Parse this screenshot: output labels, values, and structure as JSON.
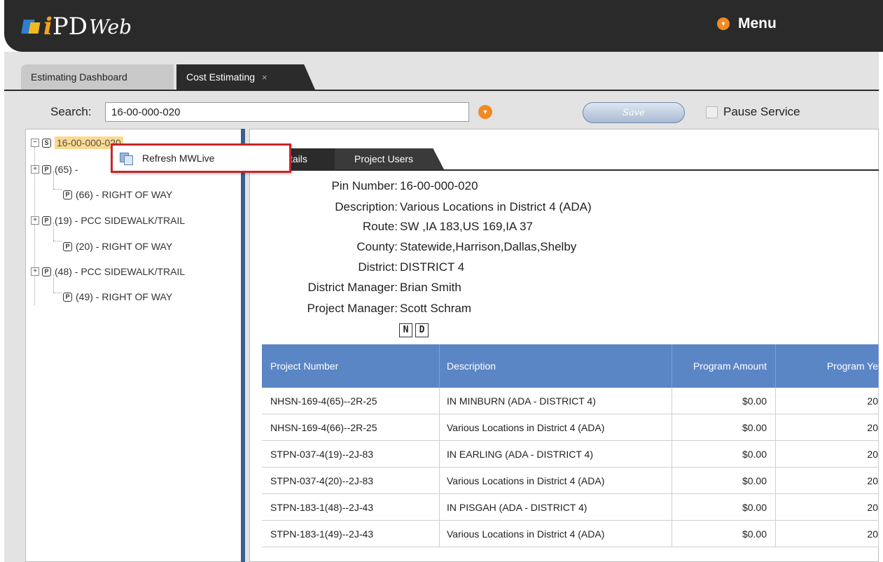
{
  "app": {
    "logo_i": "i",
    "logo_pd": "PD",
    "logo_web": "Web",
    "menu_label": "Menu"
  },
  "tabs": [
    {
      "label": "Estimating Dashboard"
    },
    {
      "label": "Cost Estimating",
      "close": "×"
    }
  ],
  "search": {
    "label": "Search:",
    "value": "16-00-000-020"
  },
  "toolbar": {
    "save_label": "Save",
    "pause_label": "Pause Service"
  },
  "tree": {
    "root": {
      "icon": "S",
      "label": "16-00-000-020",
      "expander": "−"
    },
    "items": [
      {
        "icon": "P",
        "label": "(65) -",
        "expander": "+"
      },
      {
        "icon": "P",
        "label": "(66) - RIGHT OF WAY"
      },
      {
        "icon": "P",
        "label": "(19) - PCC SIDEWALK/TRAIL",
        "expander": "+"
      },
      {
        "icon": "P",
        "label": "(20) - RIGHT OF WAY"
      },
      {
        "icon": "P",
        "label": "(48) - PCC SIDEWALK/TRAIL",
        "expander": "+"
      },
      {
        "icon": "P",
        "label": "(49) - RIGHT OF WAY"
      }
    ]
  },
  "context_menu": {
    "label": "Refresh MWLive"
  },
  "detail_tabs": [
    {
      "label": "tails"
    },
    {
      "label": "Project Users"
    }
  ],
  "details": [
    {
      "label": "Pin Number:",
      "value": "16-00-000-020"
    },
    {
      "label": "Description:",
      "value": "Various Locations in District 4 (ADA)"
    },
    {
      "label": "Route:",
      "value": "SW ,IA 183,US 169,IA 37"
    },
    {
      "label": "County:",
      "value": "Statewide,Harrison,Dallas,Shelby"
    },
    {
      "label": "District:",
      "value": "DISTRICT 4"
    },
    {
      "label": "District Manager:",
      "value": "Brian Smith"
    },
    {
      "label": "Project Manager:",
      "value": "Scott Schram"
    }
  ],
  "nd_buttons": {
    "n": "N",
    "d": "D"
  },
  "grid": {
    "headers": [
      "Project Number",
      "Description",
      "Program Amount",
      "Program Ye"
    ],
    "rows": [
      [
        "NHSN-169-4(65)--2R-25",
        "IN MINBURN (ADA - DISTRICT 4)",
        "$0.00",
        "20"
      ],
      [
        "NHSN-169-4(66)--2R-25",
        "Various Locations in District 4 (ADA)",
        "$0.00",
        "20"
      ],
      [
        "STPN-037-4(19)--2J-83",
        "IN EARLING (ADA - DISTRICT 4)",
        "$0.00",
        "20"
      ],
      [
        "STPN-037-4(20)--2J-83",
        "Various Locations in District 4 (ADA)",
        "$0.00",
        "20"
      ],
      [
        "STPN-183-1(48)--2J-43",
        "IN PISGAH (ADA - DISTRICT 4)",
        "$0.00",
        "20"
      ],
      [
        "STPN-183-1(49)--2J-43",
        "Various Locations in District 4 (ADA)",
        "$0.00",
        "20"
      ]
    ]
  },
  "colors": {
    "topbar": "#2a2a2a",
    "accent_orange": "#f08a24",
    "grid_header": "#5b86c6",
    "highlight": "#fbd98f",
    "context_border": "#c8262c"
  }
}
